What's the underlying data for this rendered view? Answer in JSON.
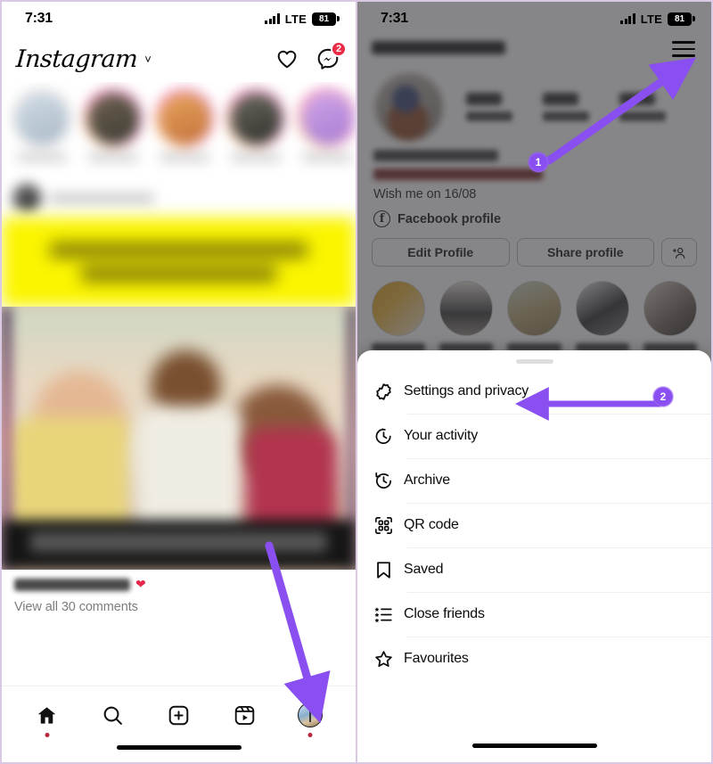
{
  "meta": {
    "accent": "#8a4ff0",
    "badge_red": "#ed2a45",
    "banner_yellow": "#fbf500"
  },
  "left_phone": {
    "status_bar": {
      "time": "7:31",
      "network": "LTE",
      "battery": "81",
      "signal_icon": "signal-bars-icon"
    },
    "header": {
      "logo": "Instagram",
      "chevron": "˅",
      "heart_icon": "heart-icon",
      "messenger_icon": "messenger-icon",
      "messenger_badge": "2"
    },
    "stories": [
      {
        "ring": "gray",
        "name": ""
      },
      {
        "ring": "grad",
        "name": ""
      },
      {
        "ring": "grad",
        "name": ""
      },
      {
        "ring": "grad",
        "name": ""
      },
      {
        "ring": "grad",
        "name": ""
      }
    ],
    "post": {
      "caption_username": "",
      "view_comments": "View all 30 comments"
    },
    "tabbar": [
      {
        "name": "home",
        "icon": "home-icon",
        "dot": true
      },
      {
        "name": "search",
        "icon": "search-icon",
        "dot": false
      },
      {
        "name": "create",
        "icon": "plus-square-icon",
        "dot": false
      },
      {
        "name": "reels",
        "icon": "reels-icon",
        "dot": false
      },
      {
        "name": "profile",
        "icon": "profile-avatar-icon",
        "dot": true
      }
    ]
  },
  "right_phone": {
    "status_bar": {
      "time": "7:31",
      "network": "LTE",
      "battery": "81",
      "signal_icon": "signal-bars-icon"
    },
    "profile": {
      "menu_icon": "hamburger-menu-icon",
      "bio_line_wish": "Wish me on 16/08",
      "facebook_label": "Facebook profile",
      "facebook_icon": "facebook-icon",
      "buttons": {
        "edit_profile": "Edit Profile",
        "share_profile": "Share profile",
        "add_person_icon": "add-person-icon"
      },
      "highlights_count": 5
    },
    "sheet": {
      "grabber": "sheet-grabber",
      "items": [
        {
          "label": "Settings and privacy",
          "icon": "gear-icon"
        },
        {
          "label": "Your activity",
          "icon": "activity-clock-icon"
        },
        {
          "label": "Archive",
          "icon": "archive-clock-icon"
        },
        {
          "label": "QR code",
          "icon": "qr-code-icon"
        },
        {
          "label": "Saved",
          "icon": "bookmark-icon"
        },
        {
          "label": "Close friends",
          "icon": "close-friends-list-icon"
        },
        {
          "label": "Favourites",
          "icon": "star-icon"
        }
      ]
    }
  },
  "annotations": [
    {
      "number": "1",
      "target": "hamburger-menu-icon",
      "direction": "up-right"
    },
    {
      "number": "2",
      "target": "settings-and-privacy-row",
      "direction": "left"
    },
    {
      "number": "",
      "target": "profile-tab",
      "direction": "down-right"
    }
  ]
}
